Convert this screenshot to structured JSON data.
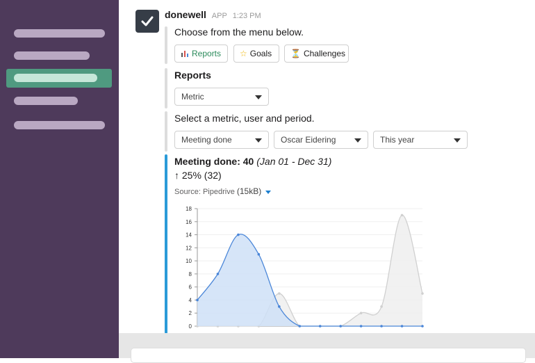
{
  "sidebar": {
    "item_count": 5,
    "active_index": 2
  },
  "message": {
    "app_name": "donewell",
    "app_tag": "APP",
    "time": "1:23 PM",
    "intro": "Choose from the menu below.",
    "buttons": [
      {
        "icon": "bar-chart-icon",
        "label": "Reports",
        "color": "#2a8a5a"
      },
      {
        "icon": "star-icon",
        "label": "Goals"
      },
      {
        "icon": "hourglass-icon",
        "label": "Challenges"
      }
    ],
    "reports_heading": "Reports",
    "metric_select": "Metric",
    "select_prompt": "Select a metric, user and period.",
    "filters": {
      "metric": "Meeting done",
      "user": "Oscar Eidering",
      "period": "This year"
    },
    "result_title": "Meeting done: 40",
    "result_range": "(Jan 01 - Dec 31)",
    "result_change": "↑ 25% (32)",
    "source": "Source: Pipedrive",
    "source_size": "(15kB)"
  },
  "chart_data": {
    "type": "area",
    "ylim": [
      0,
      18
    ],
    "yticks": [
      0,
      2,
      4,
      6,
      8,
      10,
      12,
      14,
      16,
      18
    ],
    "x": [
      0,
      1,
      2,
      3,
      4,
      5,
      6,
      7,
      8,
      9,
      10,
      11
    ],
    "series": [
      {
        "color": "#4a86d8",
        "fill": "#cfe0f7",
        "values": [
          4,
          8,
          14,
          11,
          3,
          0,
          0,
          0,
          0,
          0,
          0,
          0
        ]
      },
      {
        "color": "#d0d0d0",
        "fill": "#eeeeee",
        "values": [
          0,
          0,
          0,
          0,
          5,
          0,
          0,
          0,
          2,
          3,
          17,
          5
        ]
      }
    ]
  }
}
